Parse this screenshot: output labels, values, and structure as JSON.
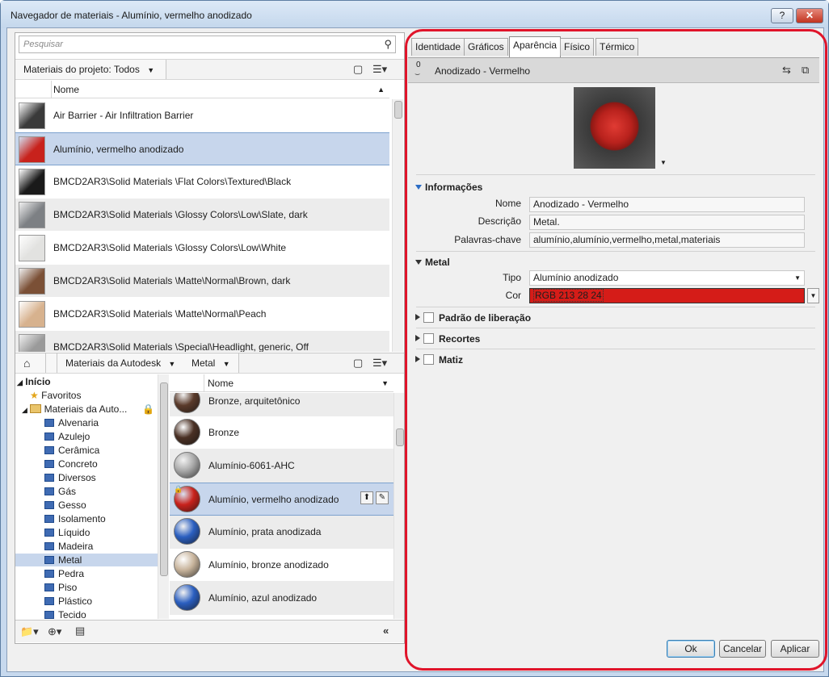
{
  "window": {
    "title": "Navegador de materiais - Alumínio, vermelho anodizado",
    "help": "?",
    "close": "✕"
  },
  "search": {
    "placeholder": "Pesquisar"
  },
  "project": {
    "dropdown": "Materiais do projeto: Todos",
    "column": "Nome",
    "items": [
      {
        "label": "Air Barrier - Air Infiltration Barrier",
        "color": "#3a3a3a"
      },
      {
        "label": "Alumínio, vermelho anodizado",
        "color": "#c8221c"
      },
      {
        "label": "BMCD2AR3\\Solid Materials \\Flat Colors\\Textured\\Black",
        "color": "#1a1a1a"
      },
      {
        "label": "BMCD2AR3\\Solid Materials \\Glossy Colors\\Low\\Slate, dark",
        "color": "#7d8084"
      },
      {
        "label": "BMCD2AR3\\Solid Materials \\Glossy Colors\\Low\\White",
        "color": "#e2e2e0"
      },
      {
        "label": "BMCD2AR3\\Solid Materials \\Matte\\Normal\\Brown, dark",
        "color": "#7b5036"
      },
      {
        "label": "BMCD2AR3\\Solid Materials \\Matte\\Normal\\Peach",
        "color": "#d7b28e"
      },
      {
        "label": "BMCD2AR3\\Solid Materials \\Special\\Headlight, generic, Off",
        "color": "#9a9a9a"
      }
    ]
  },
  "library": {
    "crumbs": [
      "Materiais da Autodesk",
      "Metal"
    ],
    "column": "Nome",
    "tree": {
      "root": "Início",
      "favorites": "Favoritos",
      "lib": "Materiais da Auto...",
      "categories": [
        "Alvenaria",
        "Azulejo",
        "Cerâmica",
        "Concreto",
        "Diversos",
        "Gás",
        "Gesso",
        "Isolamento",
        "Líquido",
        "Madeira",
        "Metal",
        "Pedra",
        "Piso",
        "Plástico",
        "Tecido"
      ]
    },
    "items": [
      {
        "label": "Bronze, arquitetônico",
        "color": "#5a3a2a"
      },
      {
        "label": "Bronze",
        "color": "#4a3024"
      },
      {
        "label": "Alumínio-6061-AHC",
        "color": "#a9a9a9"
      },
      {
        "label": "Alumínio, vermelho anodizado",
        "color": "#c8221c"
      },
      {
        "label": "Alumínio, prata anodizada",
        "color": "#2b5fc0"
      },
      {
        "label": "Alumínio, bronze anodizado",
        "color": "#c8b49c"
      },
      {
        "label": "Alumínio, azul anodizado",
        "color": "#2b5fc0"
      }
    ]
  },
  "tabs": [
    "Identidade",
    "Gráficos",
    "Aparência",
    "Físico",
    "Térmico"
  ],
  "asset": {
    "count": "0",
    "name": "Anodizado - Vermelho"
  },
  "info": {
    "section": "Informações",
    "name_label": "Nome",
    "name": "Anodizado - Vermelho",
    "desc_label": "Descrição",
    "desc": "Metal.",
    "kw_label": "Palavras-chave",
    "kw": "alumínio,alumínio,vermelho,metal,materiais"
  },
  "metal": {
    "section": "Metal",
    "type_label": "Tipo",
    "type": "Alumínio anodizado",
    "color_label": "Cor",
    "color_text": "RGB 213 28 24",
    "color": "#d51c18"
  },
  "sections": [
    "Padrão de liberação",
    "Recortes",
    "Matiz"
  ],
  "buttons": {
    "ok": "Ok",
    "cancel": "Cancelar",
    "apply": "Aplicar"
  }
}
